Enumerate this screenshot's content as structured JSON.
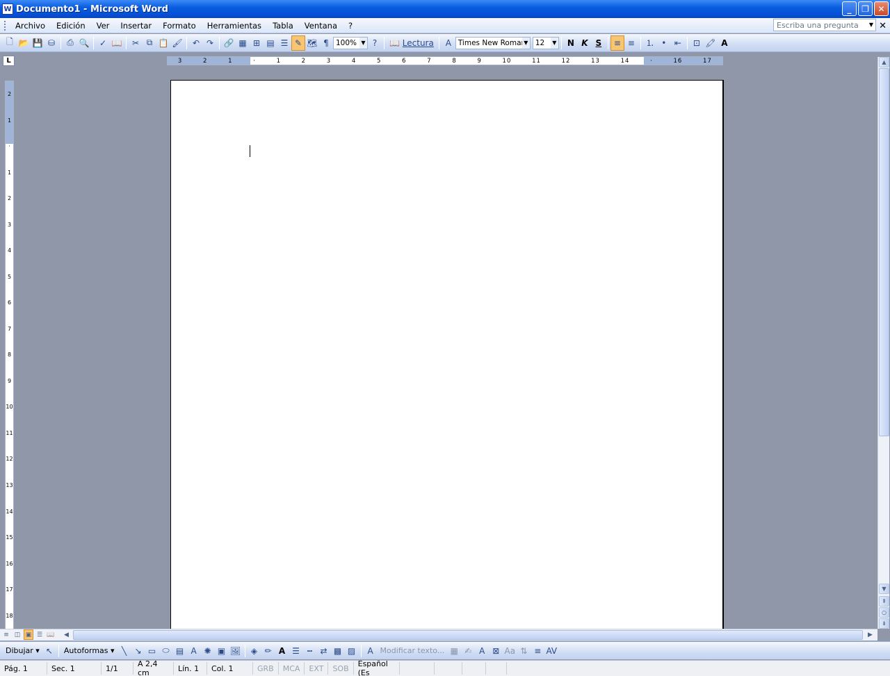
{
  "window": {
    "title": "Documento1 - Microsoft Word",
    "app_icon": "W"
  },
  "menu": {
    "items": [
      "Archivo",
      "Edición",
      "Ver",
      "Insertar",
      "Formato",
      "Herramientas",
      "Tabla",
      "Ventana",
      "?"
    ],
    "ask_placeholder": "Escriba una pregunta"
  },
  "toolbar": {
    "zoom": "100%",
    "reading_label": "Lectura",
    "font_name": "Times New Roman",
    "font_size": "12",
    "bold": "N",
    "italic": "K",
    "strike": "S"
  },
  "ruler": {
    "horizontal_ticks": [
      "3",
      "2",
      "1",
      "",
      "1",
      "2",
      "3",
      "4",
      "5",
      "6",
      "7",
      "8",
      "9",
      "10",
      "11",
      "12",
      "13",
      "14",
      "",
      "16",
      "17"
    ],
    "vertical_ticks": [
      "2",
      "1",
      "",
      "1",
      "2",
      "3",
      "4",
      "5",
      "6",
      "7",
      "8",
      "9",
      "10",
      "11",
      "12",
      "13",
      "14",
      "15",
      "16",
      "17",
      "18"
    ]
  },
  "drawbar": {
    "draw_label": "Dibujar",
    "autoshapes_label": "Autoformas",
    "edit_text_label": "Modificar texto..."
  },
  "status": {
    "page": "Pág. 1",
    "section": "Sec. 1",
    "pages": "1/1",
    "position": "A 2,4 cm",
    "line": "Lín. 1",
    "column": "Col. 1",
    "rec": "GRB",
    "trk": "MCA",
    "ext": "EXT",
    "ovr": "SOB",
    "language": "Español (Es"
  }
}
